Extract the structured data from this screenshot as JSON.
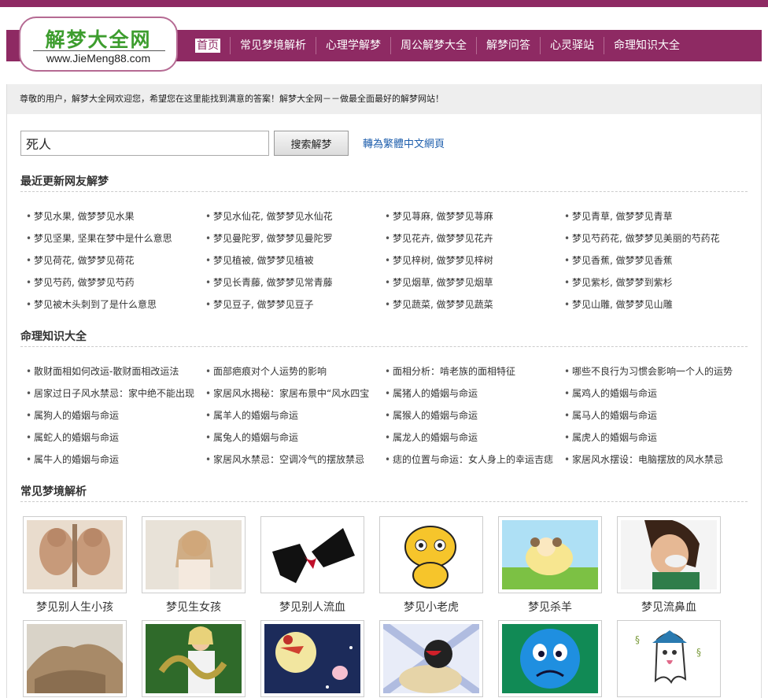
{
  "logo": {
    "title": "解梦大全网",
    "url": "www.JieMeng88.com"
  },
  "nav": [
    "首页",
    "常见梦境解析",
    "心理学解梦",
    "周公解梦大全",
    "解梦问答",
    "心灵驿站",
    "命理知识大全"
  ],
  "welcome": "尊敬的用户，解梦大全网欢迎您，希望您在这里能找到满意的答案！解梦大全网－－做最全面最好的解梦网站！",
  "search": {
    "value": "死人",
    "button": "搜索解梦",
    "trad_link": "轉為繁體中文網頁"
  },
  "recent": {
    "title": "最近更新网友解梦",
    "items": [
      "梦见水果, 做梦梦见水果",
      "梦见水仙花, 做梦梦见水仙花",
      "梦见荨麻, 做梦梦见荨麻",
      "梦见青草, 做梦梦见青草",
      "梦见坚果, 坚果在梦中是什么意思",
      "梦见曼陀罗, 做梦梦见曼陀罗",
      "梦见花卉, 做梦梦见花卉",
      "梦见芍药花, 做梦梦见美丽的芍药花",
      "梦见荷花, 做梦梦见荷花",
      "梦见植被, 做梦梦见植被",
      "梦见梓树, 做梦梦见梓树",
      "梦见香蕉, 做梦梦见香蕉",
      "梦见芍药, 做梦梦见芍药",
      "梦见长青藤, 做梦梦见常青藤",
      "梦见烟草, 做梦梦见烟草",
      "梦见紫杉, 做梦梦到紫杉",
      "梦见被木头刺到了是什么意思",
      "梦见豆子, 做梦梦见豆子",
      "梦见蔬菜, 做梦梦见蔬菜",
      "梦见山雕, 做梦梦见山雕"
    ]
  },
  "fortune": {
    "title": "命理知识大全",
    "items": [
      "散财面相如何改运-散财面相改运法",
      "面部疤痕对个人运势的影响",
      "面相分析：啃老族的面相特征",
      "哪些不良行为习惯会影响一个人的运势",
      "居家过日子风水禁忌：家中绝不能出现",
      "家居风水揭秘：家居布景中“风水四宝",
      "属猪人的婚姻与命运",
      "属鸡人的婚姻与命运",
      "属狗人的婚姻与命运",
      "属羊人的婚姻与命运",
      "属猴人的婚姻与命运",
      "属马人的婚姻与命运",
      "属蛇人的婚姻与命运",
      "属兔人的婚姻与命运",
      "属龙人的婚姻与命运",
      "属虎人的婚姻与命运",
      "属牛人的婚姻与命运",
      "家居风水禁忌：空调冷气的摆放禁忌",
      "痣的位置与命运：女人身上的幸运吉痣",
      "家居风水摆设：电脑摆放的风水禁忌"
    ]
  },
  "common": {
    "title": "常见梦境解析",
    "items": [
      {
        "caption": "梦见别人生小孩",
        "icon": "babies-photo"
      },
      {
        "caption": "梦见生女孩",
        "icon": "girl-photo"
      },
      {
        "caption": "梦见别人流血",
        "icon": "cartoon-blood-image"
      },
      {
        "caption": "梦见小老虎",
        "icon": "cartoon-tiger-image"
      },
      {
        "caption": "梦见杀羊",
        "icon": "cartoon-sheep-image"
      },
      {
        "caption": "梦见流鼻血",
        "icon": "nosebleed-photo"
      },
      {
        "caption": "",
        "icon": "mud-photo"
      },
      {
        "caption": "",
        "icon": "snake-woman-photo"
      },
      {
        "caption": "",
        "icon": "moon-night-image"
      },
      {
        "caption": "",
        "icon": "cartoon-penguin-image"
      },
      {
        "caption": "",
        "icon": "sad-face-image"
      },
      {
        "caption": "",
        "icon": "cartoon-ghost-image"
      }
    ]
  }
}
